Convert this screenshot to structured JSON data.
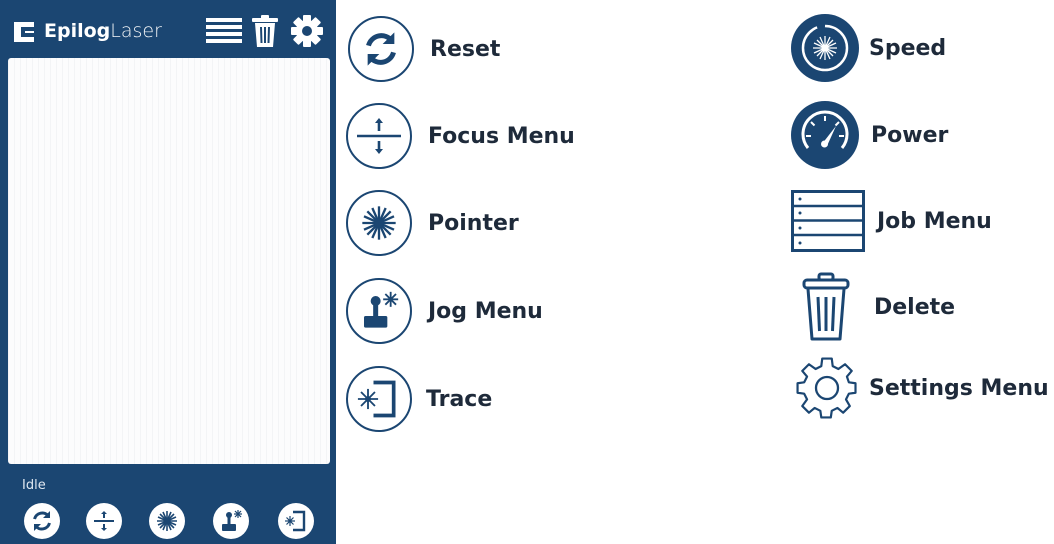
{
  "app": {
    "logo_bold": "Epilog",
    "logo_light": "Laser",
    "status": "Idle"
  },
  "header_icons": [
    "job-menu-icon",
    "delete-icon",
    "settings-icon"
  ],
  "toolbar": [
    "reset-icon",
    "focus-icon",
    "pointer-icon",
    "jog-icon",
    "trace-icon"
  ],
  "legend": {
    "reset": "Reset",
    "focus": "Focus Menu",
    "pointer": "Pointer",
    "jog": "Jog Menu",
    "trace": "Trace",
    "speed": "Speed",
    "power": "Power",
    "job": "Job Menu",
    "delete": "Delete",
    "settings": "Settings Menu"
  },
  "colors": {
    "brand": "#1b4672",
    "text": "#1e2a3a"
  }
}
